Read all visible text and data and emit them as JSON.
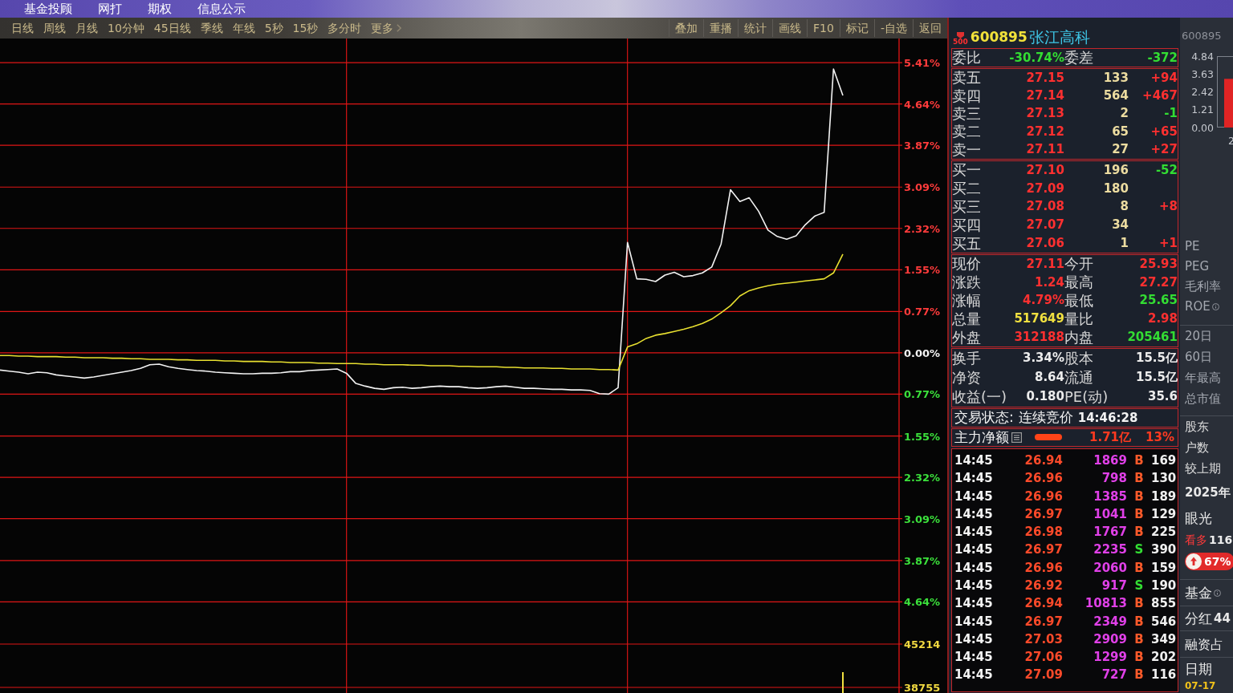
{
  "top_menu": [
    {
      "label": "基金投顾"
    },
    {
      "label": "网打"
    },
    {
      "label": "期权"
    },
    {
      "label": "信息公示"
    }
  ],
  "period_toolbar": {
    "periods": [
      {
        "label": "日线",
        "selected": false
      },
      {
        "label": "周线",
        "selected": false
      },
      {
        "label": "月线",
        "selected": false
      },
      {
        "label": "10分钟",
        "selected": false
      },
      {
        "label": "45日线",
        "selected": false
      },
      {
        "label": "季线",
        "selected": false
      },
      {
        "label": "年线",
        "selected": false
      },
      {
        "label": "5秒",
        "selected": false
      },
      {
        "label": "15秒",
        "selected": false
      },
      {
        "label": "多分时",
        "selected": false
      }
    ],
    "more": {
      "label": "更多"
    },
    "tools": [
      {
        "label": "叠加"
      },
      {
        "label": "重播"
      },
      {
        "label": "统计"
      },
      {
        "label": "画线"
      },
      {
        "label": "F10"
      },
      {
        "label": "标记"
      },
      {
        "label": "-自选"
      },
      {
        "label": "返回"
      }
    ]
  },
  "intraday_chart": {
    "chart_data": {
      "type": "line",
      "grid": true,
      "ylim": [
        -6.34,
        5.86
      ],
      "yticks": [
        {
          "value": 5.41,
          "label": "5.41%"
        },
        {
          "value": 4.64,
          "label": "4.64%"
        },
        {
          "value": 3.87,
          "label": "3.87%"
        },
        {
          "value": 3.09,
          "label": "3.09%"
        },
        {
          "value": 2.32,
          "label": "2.32%"
        },
        {
          "value": 1.55,
          "label": "1.55%"
        },
        {
          "value": 0.77,
          "label": "0.77%"
        },
        {
          "value": 0,
          "label": "0.00%"
        },
        {
          "value": -0.77,
          "label": "0.77%"
        },
        {
          "value": -1.55,
          "label": "1.55%"
        },
        {
          "value": -2.32,
          "label": "2.32%"
        },
        {
          "value": -3.09,
          "label": "3.09%"
        },
        {
          "value": -3.87,
          "label": "3.87%"
        },
        {
          "value": -4.64,
          "label": "4.64%"
        }
      ],
      "categories": [
        null,
        null,
        null,
        null,
        null,
        null,
        null,
        null,
        null,
        null,
        null,
        null,
        null,
        null,
        null,
        null,
        null,
        null,
        null,
        null,
        null,
        null,
        null,
        null,
        null,
        null,
        null,
        null,
        null,
        null,
        null,
        null,
        null,
        null,
        null,
        null,
        null,
        null,
        null,
        null,
        null,
        null,
        null,
        null,
        null,
        null,
        null,
        null,
        null,
        null,
        null,
        null,
        null,
        null,
        null,
        null,
        null,
        null,
        null,
        null,
        null,
        null,
        null,
        null,
        null,
        null,
        null,
        null,
        null,
        null,
        null,
        null,
        null,
        null,
        null,
        null,
        null,
        null,
        null,
        null,
        null,
        null,
        null,
        null,
        null,
        null,
        null,
        null,
        null,
        null,
        null,
        null,
        null,
        null,
        null,
        null,
        null
      ],
      "series": [
        {
          "color": "#f2f2f2",
          "values": [
            -0.32,
            -0.34,
            -0.36,
            -0.39,
            -0.36,
            -0.37,
            -0.41,
            -0.43,
            -0.45,
            -0.47,
            -0.45,
            -0.42,
            -0.39,
            -0.36,
            -0.33,
            -0.29,
            -0.22,
            -0.21,
            -0.26,
            -0.29,
            -0.31,
            -0.33,
            -0.34,
            -0.36,
            -0.37,
            -0.38,
            -0.39,
            -0.39,
            -0.38,
            -0.38,
            -0.37,
            -0.35,
            -0.35,
            -0.33,
            -0.32,
            -0.31,
            -0.3,
            -0.38,
            -0.57,
            -0.62,
            -0.66,
            -0.68,
            -0.65,
            -0.64,
            -0.66,
            -0.65,
            -0.63,
            -0.62,
            -0.63,
            -0.63,
            -0.65,
            -0.66,
            -0.65,
            -0.63,
            -0.62,
            -0.64,
            -0.66,
            -0.66,
            -0.67,
            -0.68,
            -0.68,
            -0.69,
            -0.69,
            -0.7,
            -0.76,
            -0.77,
            -0.65,
            2.06,
            1.38,
            1.37,
            1.33,
            1.45,
            1.5,
            1.42,
            1.44,
            1.49,
            1.6,
            2.03,
            3.04,
            2.82,
            2.89,
            2.64,
            2.29,
            2.17,
            2.12,
            2.18,
            2.39,
            2.55,
            2.62,
            5.29,
            4.8,
            null,
            null,
            null,
            null,
            null,
            null
          ]
        },
        {
          "color": "#e8e030",
          "values": [
            -0.05,
            -0.05,
            -0.06,
            -0.06,
            -0.07,
            -0.07,
            -0.07,
            -0.08,
            -0.08,
            -0.09,
            -0.09,
            -0.09,
            -0.1,
            -0.1,
            -0.11,
            -0.11,
            -0.12,
            -0.12,
            -0.12,
            -0.13,
            -0.13,
            -0.14,
            -0.14,
            -0.14,
            -0.15,
            -0.15,
            -0.16,
            -0.16,
            -0.16,
            -0.17,
            -0.17,
            -0.18,
            -0.18,
            -0.18,
            -0.19,
            -0.19,
            -0.2,
            -0.2,
            -0.2,
            -0.21,
            -0.21,
            -0.22,
            -0.22,
            -0.22,
            -0.23,
            -0.23,
            -0.24,
            -0.24,
            -0.24,
            -0.25,
            -0.25,
            -0.26,
            -0.26,
            -0.26,
            -0.27,
            -0.27,
            -0.28,
            -0.28,
            -0.28,
            -0.29,
            -0.29,
            -0.3,
            -0.3,
            -0.3,
            -0.31,
            -0.31,
            -0.32,
            0.11,
            0.17,
            0.27,
            0.33,
            0.36,
            0.4,
            0.44,
            0.49,
            0.55,
            0.63,
            0.75,
            0.88,
            1.06,
            1.16,
            1.21,
            1.25,
            1.28,
            1.3,
            1.32,
            1.34,
            1.36,
            1.38,
            1.49,
            1.84,
            null,
            null,
            null,
            null,
            null,
            null
          ]
        }
      ]
    },
    "volume_axis_labels": [
      "45214",
      "38755"
    ]
  },
  "quote_panel": {
    "badge": "500",
    "code": "600895",
    "name": "张江高科",
    "order_ratio": {
      "label": "委比",
      "value": {
        "text": "-30.74%",
        "color": "#33dd33"
      },
      "diff_label": "委差",
      "diff": {
        "text": "-372",
        "color": "#33dd33"
      }
    },
    "asks": [
      {
        "label": "卖五",
        "price": "27.15",
        "volume": "133",
        "change": {
          "text": "+94",
          "color": "#ff3030"
        }
      },
      {
        "label": "卖四",
        "price": "27.14",
        "volume": "564",
        "change": {
          "text": "+467",
          "color": "#ff3030"
        }
      },
      {
        "label": "卖三",
        "price": "27.13",
        "volume": "2",
        "change": {
          "text": "-1",
          "color": "#33dd33"
        }
      },
      {
        "label": "卖二",
        "price": "27.12",
        "volume": "65",
        "change": {
          "text": "+65",
          "color": "#ff3030"
        }
      },
      {
        "label": "卖一",
        "price": "27.11",
        "volume": "27",
        "change": {
          "text": "+27",
          "color": "#ff3030"
        }
      }
    ],
    "bids": [
      {
        "label": "买一",
        "price": "27.10",
        "volume": "196",
        "change": {
          "text": "-52",
          "color": "#33dd33"
        }
      },
      {
        "label": "买二",
        "price": "27.09",
        "volume": "180"
      },
      {
        "label": "买三",
        "price": "27.08",
        "volume": "8",
        "change": {
          "text": "+8",
          "color": "#ff3030"
        }
      },
      {
        "label": "买四",
        "price": "27.07",
        "volume": "34"
      },
      {
        "label": "买五",
        "price": "27.06",
        "volume": "1",
        "change": {
          "text": "+1",
          "color": "#ff3030"
        }
      }
    ],
    "quote": [
      {
        "label": "现价",
        "value": "27.11",
        "color": "#ff3030"
      },
      {
        "label": "今开",
        "value": "25.93",
        "color": "#ff3030"
      },
      {
        "label": "涨跌",
        "value": "1.24",
        "color": "#ff3030"
      },
      {
        "label": "最高",
        "value": "27.27",
        "color": "#ff3030"
      },
      {
        "label": "涨幅",
        "value": "4.79%",
        "color": "#ff3030"
      },
      {
        "label": "最低",
        "value": "25.65",
        "color": "#33dd33"
      },
      {
        "label": "总量",
        "value": "517649",
        "color": "#f0e040"
      },
      {
        "label": "量比",
        "value": "2.98",
        "color": "#ff3030"
      },
      {
        "label": "外盘",
        "value": "312188",
        "color": "#ff3030"
      },
      {
        "label": "内盘",
        "value": "205461",
        "color": "#33dd33"
      }
    ],
    "fundamentals": [
      {
        "label": "换手",
        "value": "3.34%"
      },
      {
        "label": "股本",
        "value": "15.5亿"
      },
      {
        "label": "净资",
        "value": "8.64"
      },
      {
        "label": "流通",
        "value": "15.5亿"
      },
      {
        "label": "收益(一)",
        "value": "0.180"
      },
      {
        "label": "PE(动)",
        "value": "35.6"
      }
    ],
    "trade_status": {
      "label": "交易状态:",
      "value": "连续竞价",
      "time": "14:46:28"
    },
    "main_force": {
      "label": "主力净额",
      "amount": "1.71亿",
      "share": "13%"
    },
    "ticks": [
      {
        "time": "14:45",
        "price": "26.94",
        "volume": "1869",
        "side": "B",
        "kind": "buy",
        "count": "169"
      },
      {
        "time": "14:45",
        "price": "26.96",
        "volume": "798",
        "side": "B",
        "kind": "buy",
        "count": "130"
      },
      {
        "time": "14:45",
        "price": "26.96",
        "volume": "1385",
        "side": "B",
        "kind": "buy",
        "count": "189"
      },
      {
        "time": "14:45",
        "price": "26.97",
        "volume": "1041",
        "side": "B",
        "kind": "buy",
        "count": "129"
      },
      {
        "time": "14:45",
        "price": "26.98",
        "volume": "1767",
        "side": "B",
        "kind": "buy",
        "count": "225"
      },
      {
        "time": "14:45",
        "price": "26.97",
        "volume": "2235",
        "side": "S",
        "kind": "sell",
        "count": "390"
      },
      {
        "time": "14:45",
        "price": "26.96",
        "volume": "2060",
        "side": "B",
        "kind": "buy",
        "count": "159"
      },
      {
        "time": "14:45",
        "price": "26.92",
        "volume": "917",
        "side": "S",
        "kind": "sell",
        "count": "190"
      },
      {
        "time": "14:45",
        "price": "26.94",
        "volume": "10813",
        "side": "B",
        "kind": "buy",
        "count": "855"
      },
      {
        "time": "14:45",
        "price": "26.97",
        "volume": "2349",
        "side": "B",
        "kind": "buy",
        "count": "546"
      },
      {
        "time": "14:45",
        "price": "27.03",
        "volume": "2909",
        "side": "B",
        "kind": "buy",
        "count": "349"
      },
      {
        "time": "14:45",
        "price": "27.06",
        "volume": "1299",
        "side": "B",
        "kind": "buy",
        "count": "202"
      },
      {
        "time": "14:45",
        "price": "27.09",
        "volume": "727",
        "side": "B",
        "kind": "buy",
        "count": "116"
      }
    ]
  },
  "info_strip": {
    "code": "600895",
    "mini_chart": {
      "chart_data": {
        "type": "bar",
        "categories": [
          "2"
        ],
        "values": [
          3.3
        ],
        "ylim": [
          0,
          4.84
        ],
        "yticks": [
          {
            "value": 4.84,
            "label": "4.84"
          },
          {
            "value": 3.63,
            "label": "3.63"
          },
          {
            "value": 2.42,
            "label": "2.42"
          },
          {
            "value": 1.21,
            "label": "1.21"
          },
          {
            "value": 0,
            "label": "0.00"
          }
        ]
      }
    },
    "valuation": [
      {
        "label": "PE",
        "info": false
      },
      {
        "label": "PEG",
        "info": false
      },
      {
        "label": "毛利率",
        "info": false
      },
      {
        "label": "ROE",
        "info": true
      }
    ],
    "range_stats": [
      {
        "label": "20日"
      },
      {
        "label": "60日"
      },
      {
        "label": "年最高"
      },
      {
        "label": "总市值"
      }
    ],
    "holder_labels": [
      "股东",
      "户数",
      "较上期"
    ],
    "report_period": "2025年",
    "vision": {
      "label": "眼光",
      "bull_label": "看多",
      "bull_count": "116",
      "bull_share": "67%"
    },
    "fund": {
      "label": "基金",
      "info": true
    },
    "dividend": {
      "label": "分红",
      "value": "44"
    },
    "margin": {
      "label": "融资占"
    },
    "date": {
      "label": "日期",
      "value": "07-17"
    }
  }
}
